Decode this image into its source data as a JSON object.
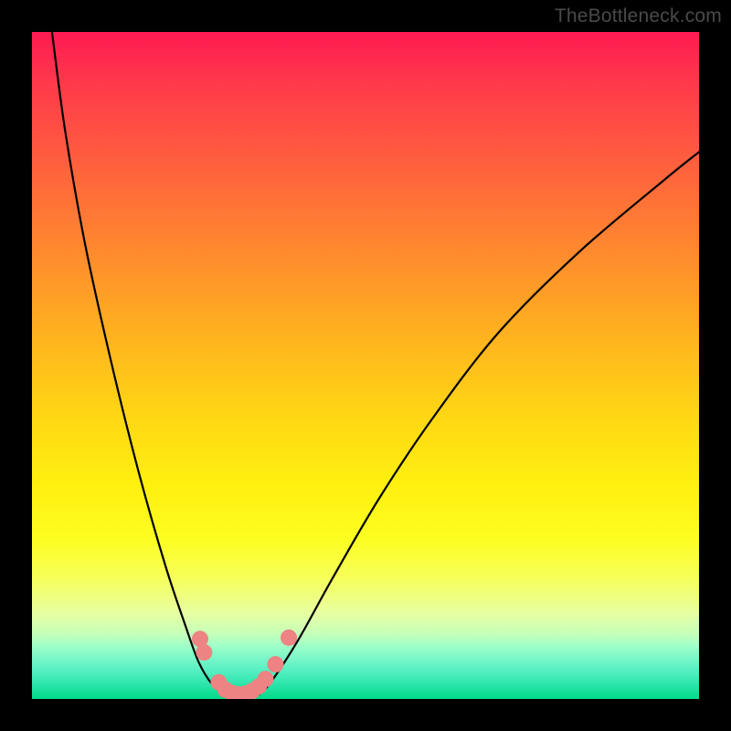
{
  "attribution": "TheBottleneck.com",
  "colors": {
    "background": "#000000",
    "curve_stroke": "#000000",
    "marker_fill": "#ed8382",
    "gradient_top": "#ff1a52",
    "gradient_bottom": "#00da88"
  },
  "chart_data": {
    "type": "line",
    "title": "",
    "xlabel": "",
    "ylabel": "",
    "xlim": [
      0,
      100
    ],
    "ylim": [
      0,
      100
    ],
    "annotations": [],
    "series": [
      {
        "name": "bottleneck-curve",
        "x": [
          3,
          5,
          8,
          12,
          16,
          20,
          23,
          25,
          27,
          28.5,
          30,
          32,
          34,
          36,
          40,
          45,
          52,
          60,
          70,
          82,
          95,
          100
        ],
        "y": [
          100,
          85,
          68,
          50,
          34,
          20,
          11,
          5.5,
          2.2,
          1.0,
          0.4,
          0.3,
          0.7,
          2.8,
          9,
          18,
          30,
          42,
          55,
          67,
          78,
          82
        ]
      }
    ],
    "markers": [
      {
        "x": 25.2,
        "y": 9.0
      },
      {
        "x": 25.8,
        "y": 7.0
      },
      {
        "x": 28.0,
        "y": 2.5
      },
      {
        "x": 29.0,
        "y": 1.4
      },
      {
        "x": 30.0,
        "y": 0.9
      },
      {
        "x": 31.0,
        "y": 0.7
      },
      {
        "x": 32.0,
        "y": 0.8
      },
      {
        "x": 33.0,
        "y": 1.2
      },
      {
        "x": 34.0,
        "y": 1.9
      },
      {
        "x": 35.0,
        "y": 3.0
      },
      {
        "x": 36.5,
        "y": 5.2
      },
      {
        "x": 38.5,
        "y": 9.2
      }
    ]
  }
}
